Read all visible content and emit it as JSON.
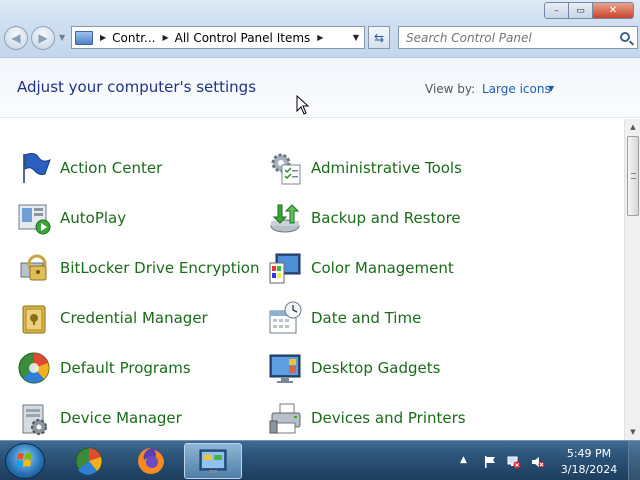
{
  "window": {
    "caption": {
      "minimize": "–",
      "maximize": "▭",
      "close": "✕"
    }
  },
  "address_bar": {
    "crumbs": [
      "Contr...",
      "All Control Panel Items"
    ]
  },
  "search": {
    "placeholder": "Search Control Panel"
  },
  "header": {
    "title": "Adjust your computer's settings",
    "view_by_label": "View by:",
    "view_by_value": "Large icons"
  },
  "items": [
    {
      "label": "Action Center",
      "icon": "flag-icon"
    },
    {
      "label": "Administrative Tools",
      "icon": "admin-tools-icon"
    },
    {
      "label": "AutoPlay",
      "icon": "autoplay-icon"
    },
    {
      "label": "Backup and Restore",
      "icon": "backup-icon"
    },
    {
      "label": "BitLocker Drive Encryption",
      "icon": "bitlocker-icon"
    },
    {
      "label": "Color Management",
      "icon": "color-management-icon"
    },
    {
      "label": "Credential Manager",
      "icon": "credential-icon"
    },
    {
      "label": "Date and Time",
      "icon": "calendar-clock-icon"
    },
    {
      "label": "Default Programs",
      "icon": "default-programs-icon"
    },
    {
      "label": "Desktop Gadgets",
      "icon": "gadgets-icon"
    },
    {
      "label": "Device Manager",
      "icon": "device-manager-icon"
    },
    {
      "label": "Devices and Printers",
      "icon": "printer-icon"
    }
  ],
  "taskbar": {
    "clock_time": "5:49 PM",
    "clock_date": "3/18/2024"
  },
  "colors": {
    "link_green": "#1a6b1a",
    "title_blue": "#1e3287",
    "taskbar": "#2c5378"
  }
}
